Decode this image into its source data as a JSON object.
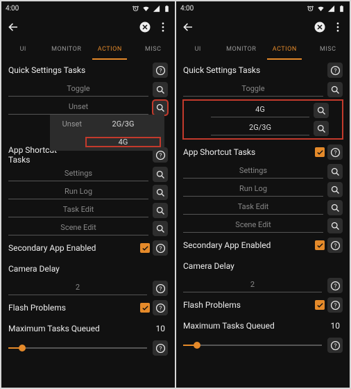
{
  "statusbar": {
    "time": "4:00"
  },
  "tabs": {
    "ui": "UI",
    "monitor": "MONITOR",
    "action": "ACTION",
    "misc": "MISC"
  },
  "sec": {
    "quick": "Quick Settings Tasks",
    "shortcut": "App Shortcut Tasks",
    "secondary": "Secondary App Enabled",
    "delay": "Camera Delay",
    "flash": "Flash Problems",
    "maxq": "Maximum Tasks Queued"
  },
  "fields": {
    "toggle": "Toggle",
    "unset": "Unset",
    "g4": "4G",
    "g23": "2G/3G",
    "settings": "Settings",
    "runlog": "Run Log",
    "taskedit": "Task Edit",
    "sceneedit": "Scene Edit",
    "delay_val": "2",
    "maxq_val": "10"
  },
  "popup": {
    "label_unset": "Unset",
    "val1": "2G/3G",
    "val2": "4G"
  },
  "slider": {
    "pct": 10
  },
  "accent": "#e58a2a"
}
